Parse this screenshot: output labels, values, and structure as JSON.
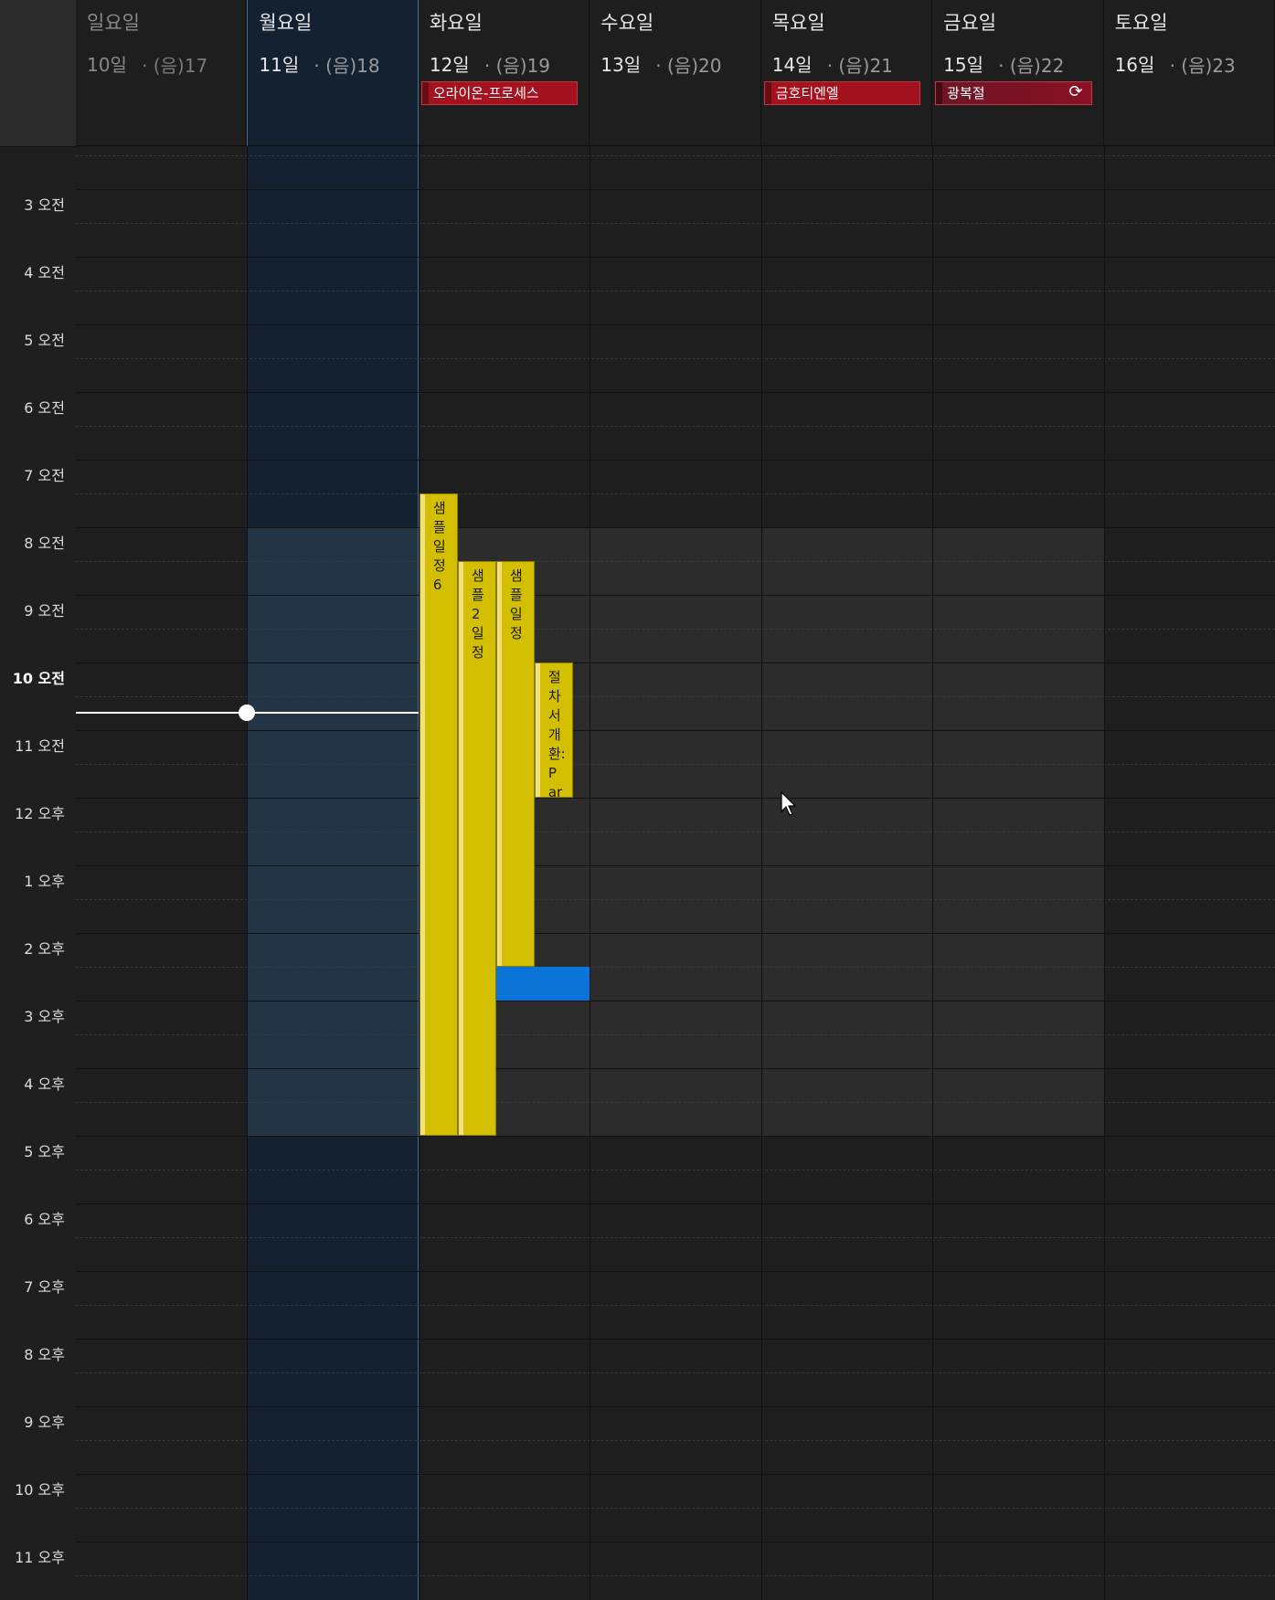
{
  "days": [
    {
      "name": "일요일",
      "date": "10일",
      "lunar": "· (음)17",
      "dim": true
    },
    {
      "name": "월요일",
      "date": "11일",
      "lunar": "· (음)18",
      "dim": false,
      "selected": true
    },
    {
      "name": "화요일",
      "date": "12일",
      "lunar": "· (음)19",
      "dim": false
    },
    {
      "name": "수요일",
      "date": "13일",
      "lunar": "· (음)20",
      "dim": false
    },
    {
      "name": "목요일",
      "date": "14일",
      "lunar": "· (음)21",
      "dim": false
    },
    {
      "name": "금요일",
      "date": "15일",
      "lunar": "· (음)22",
      "dim": false
    },
    {
      "name": "토요일",
      "date": "16일",
      "lunar": "· (음)23",
      "dim": false
    }
  ],
  "allday_events": [
    {
      "title": "오라이온-프로세스",
      "day": 2
    },
    {
      "title": "금호티엔엘",
      "day": 4
    },
    {
      "title": "광복절",
      "day": 5,
      "recurring": true
    }
  ],
  "time_labels": [
    "3 오전",
    "4 오전",
    "5 오전",
    "6 오전",
    "7 오전",
    "8 오전",
    "9 오전",
    "10 오전",
    "11 오전",
    "12 오후",
    "1 오후",
    "2 오후",
    "3 오후",
    "4 오후",
    "5 오후",
    "6 오후",
    "7 오후",
    "8 오후",
    "9 오후",
    "10 오후",
    "11 오후"
  ],
  "current_hour_label": "10 오전",
  "events": [
    {
      "title": "샘플일정6",
      "day": 2,
      "start": "07:30",
      "end": "17:00"
    },
    {
      "title": "샘플2일정",
      "day": 2,
      "start": "08:30",
      "end": "17:00"
    },
    {
      "title": "샘플일정",
      "day": 2,
      "start": "08:30",
      "end": "14:30"
    },
    {
      "title": "절차서개환:Par",
      "day": 2,
      "start": "10:00",
      "end": "12:00"
    }
  ],
  "icons": {
    "recurring": "sync-icon",
    "pointer": "mouse-cursor-icon"
  },
  "colors": {
    "event_yellow": "#d3be00",
    "allday_red": "#a3121e",
    "selection_blue": "#0a74d8",
    "today_column": "#132131"
  }
}
